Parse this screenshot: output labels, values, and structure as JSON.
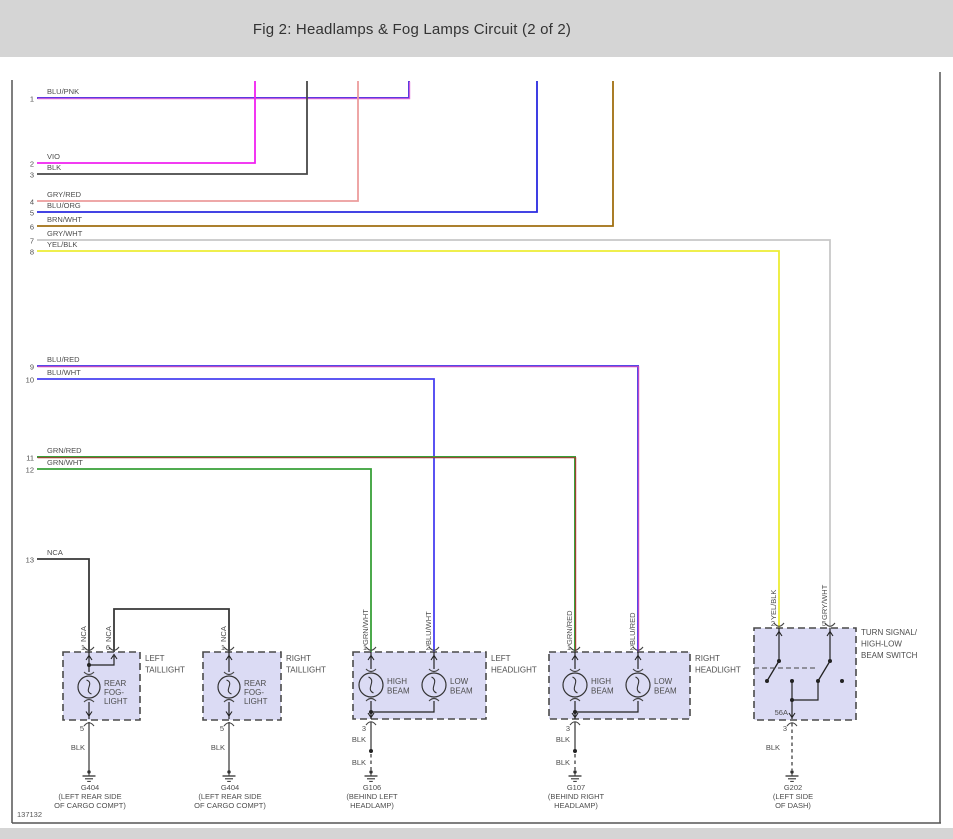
{
  "header": {
    "title": "Fig 2: Headlamps & Fog Lamps Circuit (2 of 2)"
  },
  "figure_number": "137132",
  "wires": [
    {
      "num": "1",
      "label": "BLU/PNK",
      "colors": [
        "#5a3be0",
        "#e868d8"
      ]
    },
    {
      "num": "2",
      "label": "VIO",
      "colors": [
        "#f020f0"
      ]
    },
    {
      "num": "3",
      "label": "BLK",
      "colors": [
        "#484848"
      ]
    },
    {
      "num": "4",
      "label": "GRY/RED",
      "colors": [
        "#ec9c9c"
      ]
    },
    {
      "num": "5",
      "label": "BLU/ORG",
      "colors": [
        "#2a2ae0"
      ]
    },
    {
      "num": "6",
      "label": "BRN/WHT",
      "colors": [
        "#a06f10"
      ]
    },
    {
      "num": "7",
      "label": "GRY/WHT",
      "colors": [
        "#c8c8c8"
      ]
    },
    {
      "num": "8",
      "label": "YEL/BLK",
      "colors": [
        "#eded35"
      ]
    },
    {
      "num": "9",
      "label": "BLU/RED",
      "colors": [
        "#5548e8",
        "#d848b8"
      ]
    },
    {
      "num": "10",
      "label": "BLU/WHT",
      "colors": [
        "#4840f0"
      ]
    },
    {
      "num": "11",
      "label": "GRN/RED",
      "colors": [
        "#38a038",
        "#b03030"
      ]
    },
    {
      "num": "12",
      "label": "GRN/WHT",
      "colors": [
        "#38a038"
      ]
    },
    {
      "num": "13",
      "label": "NCA",
      "colors": [
        "#383838"
      ]
    }
  ],
  "drops": [
    "NCA",
    "NCA",
    "NCA",
    "GRN/WHT",
    "BLU/WHT",
    "GRN/RED",
    "BLU/RED",
    "YEL/BLK",
    "GRY/WHT"
  ],
  "components": [
    {
      "id": "left-taillight",
      "name_lines": [
        "LEFT",
        "TAILLIGHT"
      ],
      "bulb_lines": [
        "REAR",
        "FOG-",
        "LIGHT"
      ],
      "top_pins": [
        "1",
        "6"
      ],
      "bottom_pin": "5",
      "bottom_wire": "BLK",
      "ground": {
        "id": "G404",
        "loc_lines": [
          "(LEFT REAR SIDE",
          "OF CARGO COMPT)"
        ]
      }
    },
    {
      "id": "right-taillight",
      "name_lines": [
        "RIGHT",
        "TAILLIGHT"
      ],
      "bulb_lines": [
        "REAR",
        "FOG-",
        "LIGHT"
      ],
      "top_pins": [
        "1"
      ],
      "bottom_pin": "5",
      "bottom_wire": "BLK",
      "ground": {
        "id": "G404",
        "loc_lines": [
          "(LEFT REAR SIDE",
          "OF CARGO COMPT)"
        ]
      }
    },
    {
      "id": "left-headlight",
      "name_lines": [
        "LEFT",
        "HEADLIGHT"
      ],
      "bulbs": [
        [
          "HIGH",
          "BEAM"
        ],
        [
          "LOW",
          "BEAM"
        ]
      ],
      "top_pins": [
        "1",
        "2"
      ],
      "bottom_pin": "3",
      "bottom_wires": [
        "BLK",
        "BLK"
      ],
      "ground": {
        "id": "G106",
        "loc_lines": [
          "(BEHIND LEFT",
          "HEADLAMP)"
        ]
      }
    },
    {
      "id": "right-headlight",
      "name_lines": [
        "RIGHT",
        "HEADLIGHT"
      ],
      "bulbs": [
        [
          "HIGH",
          "BEAM"
        ],
        [
          "LOW",
          "BEAM"
        ]
      ],
      "top_pins": [
        "1",
        "2"
      ],
      "bottom_pin": "3",
      "bottom_wires": [
        "BLK",
        "BLK"
      ],
      "ground": {
        "id": "G107",
        "loc_lines": [
          "(BEHIND RIGHT",
          "HEADLAMP)"
        ]
      }
    },
    {
      "id": "beam-switch",
      "name_lines": [
        "TURN SIGNAL/",
        "HIGH-LOW",
        "BEAM SWITCH"
      ],
      "top_pins": [
        "2",
        "5"
      ],
      "inner_pin": "56A",
      "bottom_pin": "3",
      "bottom_wire": "BLK",
      "ground": {
        "id": "G202",
        "loc_lines": [
          "(LEFT SIDE",
          "OF DASH)"
        ]
      }
    }
  ],
  "colors": {
    "chrome": "#d5d5d5",
    "page": "#ffffff",
    "box_fill": "#dbdbf4",
    "box_border": "#4a4a4a",
    "wire_black": "#383838",
    "label_text": "#4d4d4d",
    "border": "#555555"
  }
}
